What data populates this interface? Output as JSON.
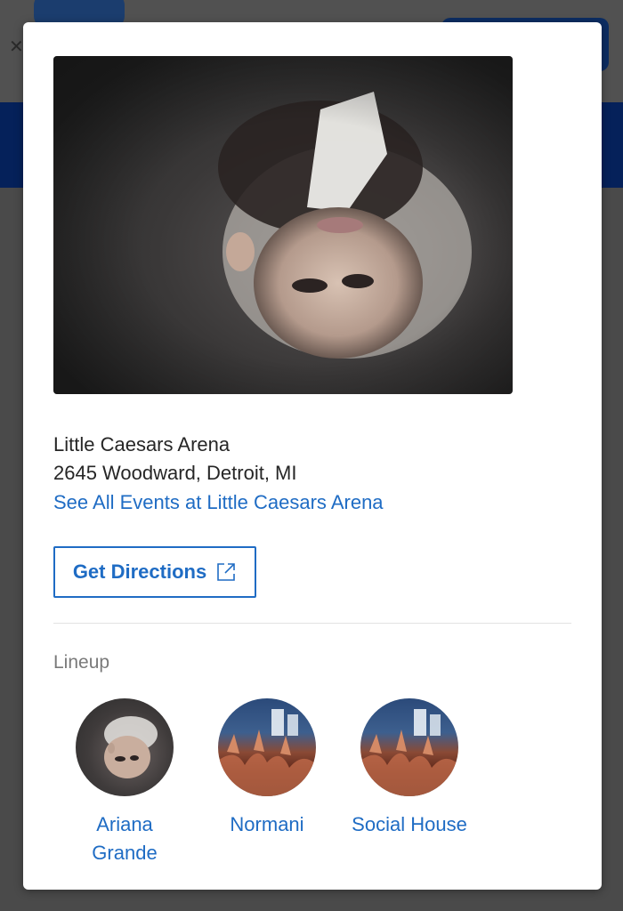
{
  "modal": {
    "venue": {
      "name": "Little Caesars Arena",
      "address": "2645 Woodward, Detroit, MI",
      "events_link": "See All Events at Little Caesars Arena"
    },
    "directions_label": "Get Directions",
    "lineup": {
      "heading": "Lineup",
      "artists": [
        {
          "name_line1": "Ariana",
          "name_line2": "Grande"
        },
        {
          "name_line1": "Normani",
          "name_line2": ""
        },
        {
          "name_line1": "Social House",
          "name_line2": ""
        }
      ]
    }
  },
  "colors": {
    "accent": "#1f6cc4",
    "text": "#262626",
    "muted": "#7a7a7a",
    "overlay": "#4d4d4d",
    "brand_band": "#05215a"
  },
  "icons": {
    "directions": "external-link-icon",
    "close": "close-icon"
  }
}
